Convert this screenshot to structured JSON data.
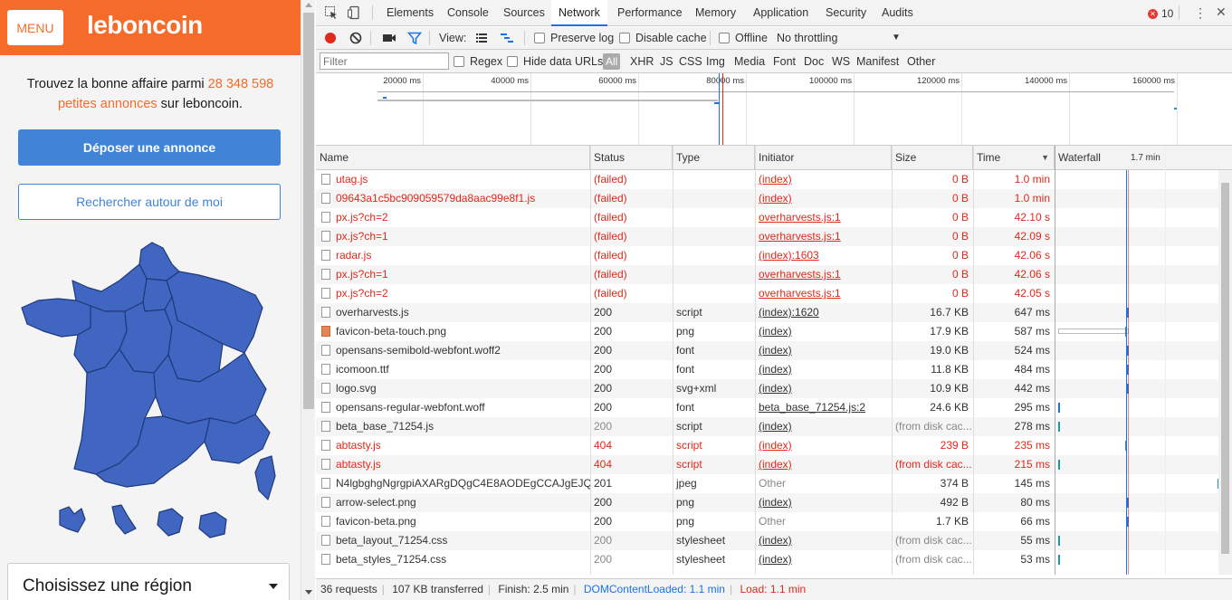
{
  "site": {
    "menu_label": "MENU",
    "logo_text": "leboncoin",
    "tagline_prefix": "Trouvez la bonne affaire parmi ",
    "tagline_count": "28 348 598",
    "tagline_link": "petites annonces",
    "tagline_suffix": " sur leboncoin.",
    "post_button": "Déposer une annonce",
    "nearby_button": "Rechercher autour de moi",
    "region_select": "Choisissez une région",
    "brand_color": "#f56b2a",
    "map_color": "#4166c1"
  },
  "devtools": {
    "tabs": [
      "Elements",
      "Console",
      "Sources",
      "Network",
      "Performance",
      "Memory",
      "Application",
      "Security",
      "Audits"
    ],
    "active_tab": "Network",
    "error_count": "10",
    "toolbar": {
      "view_label": "View:",
      "preserve_log": "Preserve log",
      "disable_cache": "Disable cache",
      "offline": "Offline",
      "throttling": "No throttling"
    },
    "filter": {
      "placeholder": "Filter",
      "regex": "Regex",
      "hide_data_urls": "Hide data URLs",
      "types": [
        "All",
        "XHR",
        "JS",
        "CSS",
        "Img",
        "Media",
        "Font",
        "Doc",
        "WS",
        "Manifest",
        "Other"
      ]
    },
    "overview_ticks": [
      "20000 ms",
      "40000 ms",
      "60000 ms",
      "80000 ms",
      "100000 ms",
      "120000 ms",
      "140000 ms",
      "160000 ms"
    ],
    "columns": [
      "Name",
      "Status",
      "Type",
      "Initiator",
      "Size",
      "Time",
      "Waterfall"
    ],
    "waterfall_tick": "1.7 min",
    "requests": [
      {
        "name": "utag.js",
        "status": "(failed)",
        "type": "",
        "initiator": "(index)",
        "size": "0 B",
        "time": "1.0 min",
        "failed": true
      },
      {
        "name": "09643a1c5bc909059579da8aac99e8f1.js",
        "status": "(failed)",
        "type": "",
        "initiator": "(index)",
        "size": "0 B",
        "time": "1.0 min",
        "failed": true
      },
      {
        "name": "px.js?ch=2",
        "status": "(failed)",
        "type": "",
        "initiator": "overharvests.js:1",
        "size": "0 B",
        "time": "42.10 s",
        "failed": true
      },
      {
        "name": "px.js?ch=1",
        "status": "(failed)",
        "type": "",
        "initiator": "overharvests.js:1",
        "size": "0 B",
        "time": "42.09 s",
        "failed": true
      },
      {
        "name": "radar.js",
        "status": "(failed)",
        "type": "",
        "initiator": "(index):1603",
        "size": "0 B",
        "time": "42.06 s",
        "failed": true
      },
      {
        "name": "px.js?ch=1",
        "status": "(failed)",
        "type": "",
        "initiator": "overharvests.js:1",
        "size": "0 B",
        "time": "42.06 s",
        "failed": true
      },
      {
        "name": "px.js?ch=2",
        "status": "(failed)",
        "type": "",
        "initiator": "overharvests.js:1",
        "size": "0 B",
        "time": "42.05 s",
        "failed": true
      },
      {
        "name": "overharvests.js",
        "status": "200",
        "type": "script",
        "initiator": "(index):1620",
        "size": "16.7 KB",
        "time": "647 ms"
      },
      {
        "name": "favicon-beta-touch.png",
        "status": "200",
        "type": "png",
        "initiator": "(index)",
        "size": "17.9 KB",
        "time": "587 ms",
        "img": true
      },
      {
        "name": "opensans-semibold-webfont.woff2",
        "status": "200",
        "type": "font",
        "initiator": "(index)",
        "size": "19.0 KB",
        "time": "524 ms"
      },
      {
        "name": "icomoon.ttf",
        "status": "200",
        "type": "font",
        "initiator": "(index)",
        "size": "11.8 KB",
        "time": "484 ms"
      },
      {
        "name": "logo.svg",
        "status": "200",
        "type": "svg+xml",
        "initiator": "(index)",
        "size": "10.9 KB",
        "time": "442 ms"
      },
      {
        "name": "opensans-regular-webfont.woff",
        "status": "200",
        "type": "font",
        "initiator": "beta_base_71254.js:2",
        "size": "24.6 KB",
        "time": "295 ms"
      },
      {
        "name": "beta_base_71254.js",
        "status": "200",
        "type": "script",
        "initiator": "(index)",
        "size": "(from disk cac...",
        "time": "278 ms",
        "cached": true
      },
      {
        "name": "abtasty.js",
        "status": "404",
        "type": "script",
        "initiator": "(index)",
        "size": "239 B",
        "time": "235 ms",
        "failed": true
      },
      {
        "name": "abtasty.js",
        "status": "404",
        "type": "script",
        "initiator": "(index)",
        "size": "(from disk cac...",
        "time": "215 ms",
        "failed": true
      },
      {
        "name": "N4lgbghgNgrgpiAXARgDQgC4E8AODEgCCAJgEJQ...",
        "status": "201",
        "type": "jpeg",
        "initiator": "Other",
        "size": "374 B",
        "time": "145 ms",
        "other": true
      },
      {
        "name": "arrow-select.png",
        "status": "200",
        "type": "png",
        "initiator": "(index)",
        "size": "492 B",
        "time": "80 ms"
      },
      {
        "name": "favicon-beta.png",
        "status": "200",
        "type": "png",
        "initiator": "Other",
        "size": "1.7 KB",
        "time": "66 ms",
        "other": true
      },
      {
        "name": "beta_layout_71254.css",
        "status": "200",
        "type": "stylesheet",
        "initiator": "(index)",
        "size": "(from disk cac...",
        "time": "55 ms",
        "cached": true
      },
      {
        "name": "beta_styles_71254.css",
        "status": "200",
        "type": "stylesheet",
        "initiator": "(index)",
        "size": "(from disk cac...",
        "time": "53 ms",
        "cached": true
      }
    ],
    "status_bar": {
      "requests": "36 requests",
      "transferred": "107 KB transferred",
      "finish": "Finish: 2.5 min",
      "dom_content_loaded": "DOMContentLoaded: 1.1 min",
      "load": "Load: 1.1 min"
    }
  }
}
